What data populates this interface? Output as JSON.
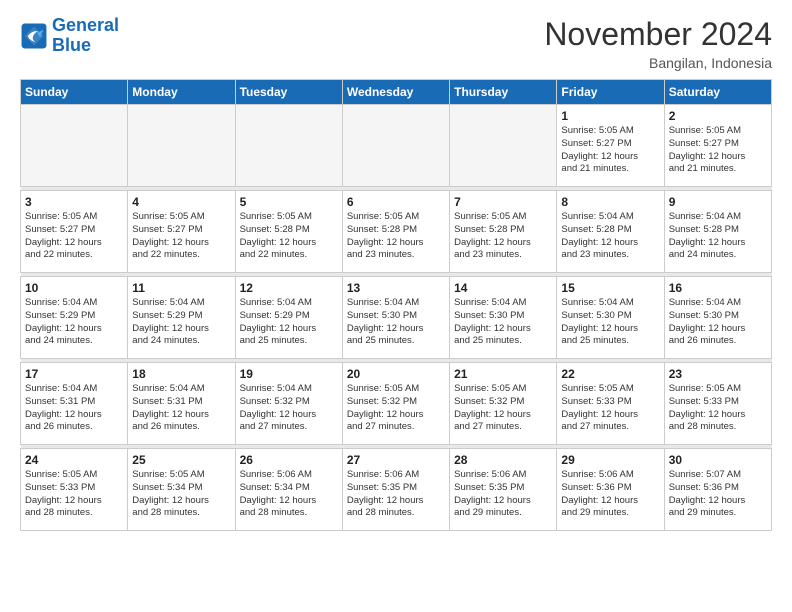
{
  "header": {
    "logo_line1": "General",
    "logo_line2": "Blue",
    "month": "November 2024",
    "location": "Bangilan, Indonesia"
  },
  "weekdays": [
    "Sunday",
    "Monday",
    "Tuesday",
    "Wednesday",
    "Thursday",
    "Friday",
    "Saturday"
  ],
  "weeks": [
    [
      {
        "day": "",
        "info": ""
      },
      {
        "day": "",
        "info": ""
      },
      {
        "day": "",
        "info": ""
      },
      {
        "day": "",
        "info": ""
      },
      {
        "day": "",
        "info": ""
      },
      {
        "day": "1",
        "info": "Sunrise: 5:05 AM\nSunset: 5:27 PM\nDaylight: 12 hours\nand 21 minutes."
      },
      {
        "day": "2",
        "info": "Sunrise: 5:05 AM\nSunset: 5:27 PM\nDaylight: 12 hours\nand 21 minutes."
      }
    ],
    [
      {
        "day": "3",
        "info": "Sunrise: 5:05 AM\nSunset: 5:27 PM\nDaylight: 12 hours\nand 22 minutes."
      },
      {
        "day": "4",
        "info": "Sunrise: 5:05 AM\nSunset: 5:27 PM\nDaylight: 12 hours\nand 22 minutes."
      },
      {
        "day": "5",
        "info": "Sunrise: 5:05 AM\nSunset: 5:28 PM\nDaylight: 12 hours\nand 22 minutes."
      },
      {
        "day": "6",
        "info": "Sunrise: 5:05 AM\nSunset: 5:28 PM\nDaylight: 12 hours\nand 23 minutes."
      },
      {
        "day": "7",
        "info": "Sunrise: 5:05 AM\nSunset: 5:28 PM\nDaylight: 12 hours\nand 23 minutes."
      },
      {
        "day": "8",
        "info": "Sunrise: 5:04 AM\nSunset: 5:28 PM\nDaylight: 12 hours\nand 23 minutes."
      },
      {
        "day": "9",
        "info": "Sunrise: 5:04 AM\nSunset: 5:28 PM\nDaylight: 12 hours\nand 24 minutes."
      }
    ],
    [
      {
        "day": "10",
        "info": "Sunrise: 5:04 AM\nSunset: 5:29 PM\nDaylight: 12 hours\nand 24 minutes."
      },
      {
        "day": "11",
        "info": "Sunrise: 5:04 AM\nSunset: 5:29 PM\nDaylight: 12 hours\nand 24 minutes."
      },
      {
        "day": "12",
        "info": "Sunrise: 5:04 AM\nSunset: 5:29 PM\nDaylight: 12 hours\nand 25 minutes."
      },
      {
        "day": "13",
        "info": "Sunrise: 5:04 AM\nSunset: 5:30 PM\nDaylight: 12 hours\nand 25 minutes."
      },
      {
        "day": "14",
        "info": "Sunrise: 5:04 AM\nSunset: 5:30 PM\nDaylight: 12 hours\nand 25 minutes."
      },
      {
        "day": "15",
        "info": "Sunrise: 5:04 AM\nSunset: 5:30 PM\nDaylight: 12 hours\nand 25 minutes."
      },
      {
        "day": "16",
        "info": "Sunrise: 5:04 AM\nSunset: 5:30 PM\nDaylight: 12 hours\nand 26 minutes."
      }
    ],
    [
      {
        "day": "17",
        "info": "Sunrise: 5:04 AM\nSunset: 5:31 PM\nDaylight: 12 hours\nand 26 minutes."
      },
      {
        "day": "18",
        "info": "Sunrise: 5:04 AM\nSunset: 5:31 PM\nDaylight: 12 hours\nand 26 minutes."
      },
      {
        "day": "19",
        "info": "Sunrise: 5:04 AM\nSunset: 5:32 PM\nDaylight: 12 hours\nand 27 minutes."
      },
      {
        "day": "20",
        "info": "Sunrise: 5:05 AM\nSunset: 5:32 PM\nDaylight: 12 hours\nand 27 minutes."
      },
      {
        "day": "21",
        "info": "Sunrise: 5:05 AM\nSunset: 5:32 PM\nDaylight: 12 hours\nand 27 minutes."
      },
      {
        "day": "22",
        "info": "Sunrise: 5:05 AM\nSunset: 5:33 PM\nDaylight: 12 hours\nand 27 minutes."
      },
      {
        "day": "23",
        "info": "Sunrise: 5:05 AM\nSunset: 5:33 PM\nDaylight: 12 hours\nand 28 minutes."
      }
    ],
    [
      {
        "day": "24",
        "info": "Sunrise: 5:05 AM\nSunset: 5:33 PM\nDaylight: 12 hours\nand 28 minutes."
      },
      {
        "day": "25",
        "info": "Sunrise: 5:05 AM\nSunset: 5:34 PM\nDaylight: 12 hours\nand 28 minutes."
      },
      {
        "day": "26",
        "info": "Sunrise: 5:06 AM\nSunset: 5:34 PM\nDaylight: 12 hours\nand 28 minutes."
      },
      {
        "day": "27",
        "info": "Sunrise: 5:06 AM\nSunset: 5:35 PM\nDaylight: 12 hours\nand 28 minutes."
      },
      {
        "day": "28",
        "info": "Sunrise: 5:06 AM\nSunset: 5:35 PM\nDaylight: 12 hours\nand 29 minutes."
      },
      {
        "day": "29",
        "info": "Sunrise: 5:06 AM\nSunset: 5:36 PM\nDaylight: 12 hours\nand 29 minutes."
      },
      {
        "day": "30",
        "info": "Sunrise: 5:07 AM\nSunset: 5:36 PM\nDaylight: 12 hours\nand 29 minutes."
      }
    ]
  ]
}
